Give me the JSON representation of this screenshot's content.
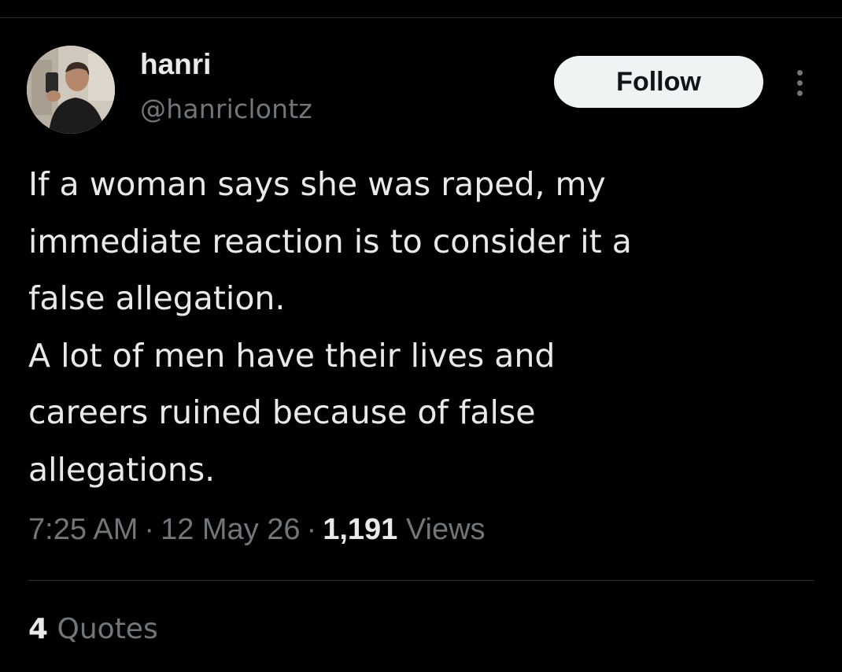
{
  "tweet": {
    "author": {
      "display_name": "hanri",
      "handle": "@hanriclontz",
      "avatar_icon": "profile-photo"
    },
    "follow_label": "Follow",
    "more_icon": "more-vertical-icon",
    "text_lines": [
      "If a woman says she was raped, my",
      "immediate reaction is to consider it a",
      "false allegation.",
      "A lot of men have their lives and",
      "careers ruined because of false",
      "allegations."
    ],
    "time": "7:25 AM",
    "date": "12 May 26",
    "separator": "·",
    "views_count": "1,191",
    "views_label": "Views",
    "quotes_count": "4",
    "quotes_label": "Quotes"
  },
  "colors": {
    "background": "#000000",
    "primary_text": "#e7e9ea",
    "secondary_text": "#71767b",
    "follow_button_bg": "#eff3f4",
    "follow_button_text": "#0f1419",
    "divider": "#2f3336"
  }
}
